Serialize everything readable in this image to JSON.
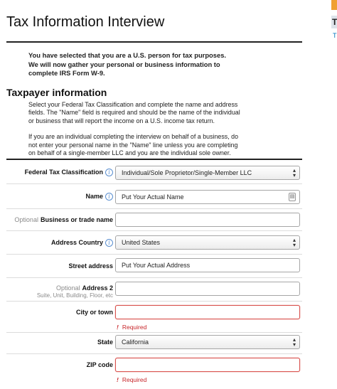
{
  "page": {
    "title": "Tax Information Interview",
    "intro": "You have selected that you are a U.S. person for tax purposes. We will now gather your personal or business information to complete IRS Form W-9."
  },
  "edge_panel": {
    "letter": "T",
    "link": "T"
  },
  "taxpayer": {
    "heading": "Taxpayer information",
    "desc1": "Select your Federal Tax Classification and complete the name and address fields. The \"Name\" field is required and should be the name of the individual or business that will report the income on a U.S. income tax return.",
    "desc2": "If you are an individual completing the interview on behalf of a business, do not enter your personal name in the \"Name\" line unless you are completing on behalf of a single-member LLC and you are the individual sole owner."
  },
  "form": {
    "tax_classification": {
      "label": "Federal Tax Classification",
      "value": "Individual/Sole Proprietor/Single-Member LLC"
    },
    "name": {
      "label": "Name",
      "value": "Put Your Actual Name"
    },
    "business_name": {
      "optional": "Optional",
      "label": "Business or trade name",
      "value": ""
    },
    "address_country": {
      "label": "Address Country",
      "value": "United States"
    },
    "street_address": {
      "label": "Street address",
      "value": "Put Your Actual Address"
    },
    "address2": {
      "optional": "Optional",
      "label": "Address 2",
      "hint": "Suite, Unit, Building, Floor, etc",
      "value": ""
    },
    "city": {
      "label": "City or town",
      "value": "",
      "error": "Required"
    },
    "state": {
      "label": "State",
      "value": "California"
    },
    "zip": {
      "label": "ZIP code",
      "value": "",
      "error": "Required"
    }
  },
  "colors": {
    "error": "#c7262a",
    "info_icon": "#5a8fd0",
    "edge_accent": "#f0a031"
  },
  "icons": [
    "info-icon",
    "select-caret-icon",
    "contact-card-icon",
    "error-mark-icon"
  ]
}
